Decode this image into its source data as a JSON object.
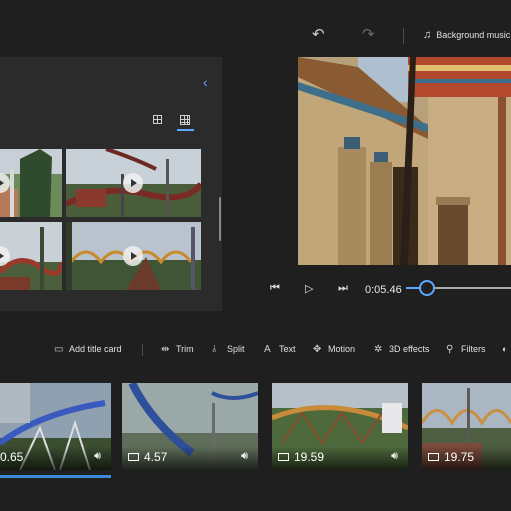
{
  "topbar": {
    "undo_icon": "undo-icon",
    "redo_icon": "redo-icon",
    "background_music_label": "Background music"
  },
  "library": {
    "collapse_icon": "chevron-left-icon",
    "views": [
      "large-grid-icon",
      "small-grid-icon"
    ]
  },
  "player": {
    "timecode": "0:05.46",
    "progress_fraction": 0.05
  },
  "toolbar": {
    "items": [
      {
        "label": "Add title card",
        "icon": "title-card-icon"
      },
      {
        "label": "Trim",
        "icon": "trim-icon"
      },
      {
        "label": "Split",
        "icon": "split-icon"
      },
      {
        "label": "Text",
        "icon": "text-icon"
      },
      {
        "label": "Motion",
        "icon": "motion-icon"
      },
      {
        "label": "3D effects",
        "icon": "3d-effects-icon"
      },
      {
        "label": "Filters",
        "icon": "filters-icon"
      }
    ]
  },
  "storyboard": {
    "clips": [
      {
        "duration": "0.65"
      },
      {
        "duration": "4.57"
      },
      {
        "duration": "19.59"
      },
      {
        "duration": "19.75"
      }
    ]
  },
  "colors": {
    "accent": "#5fa8ff",
    "panel": "#2b2b2b",
    "background": "#1f1f1f"
  }
}
